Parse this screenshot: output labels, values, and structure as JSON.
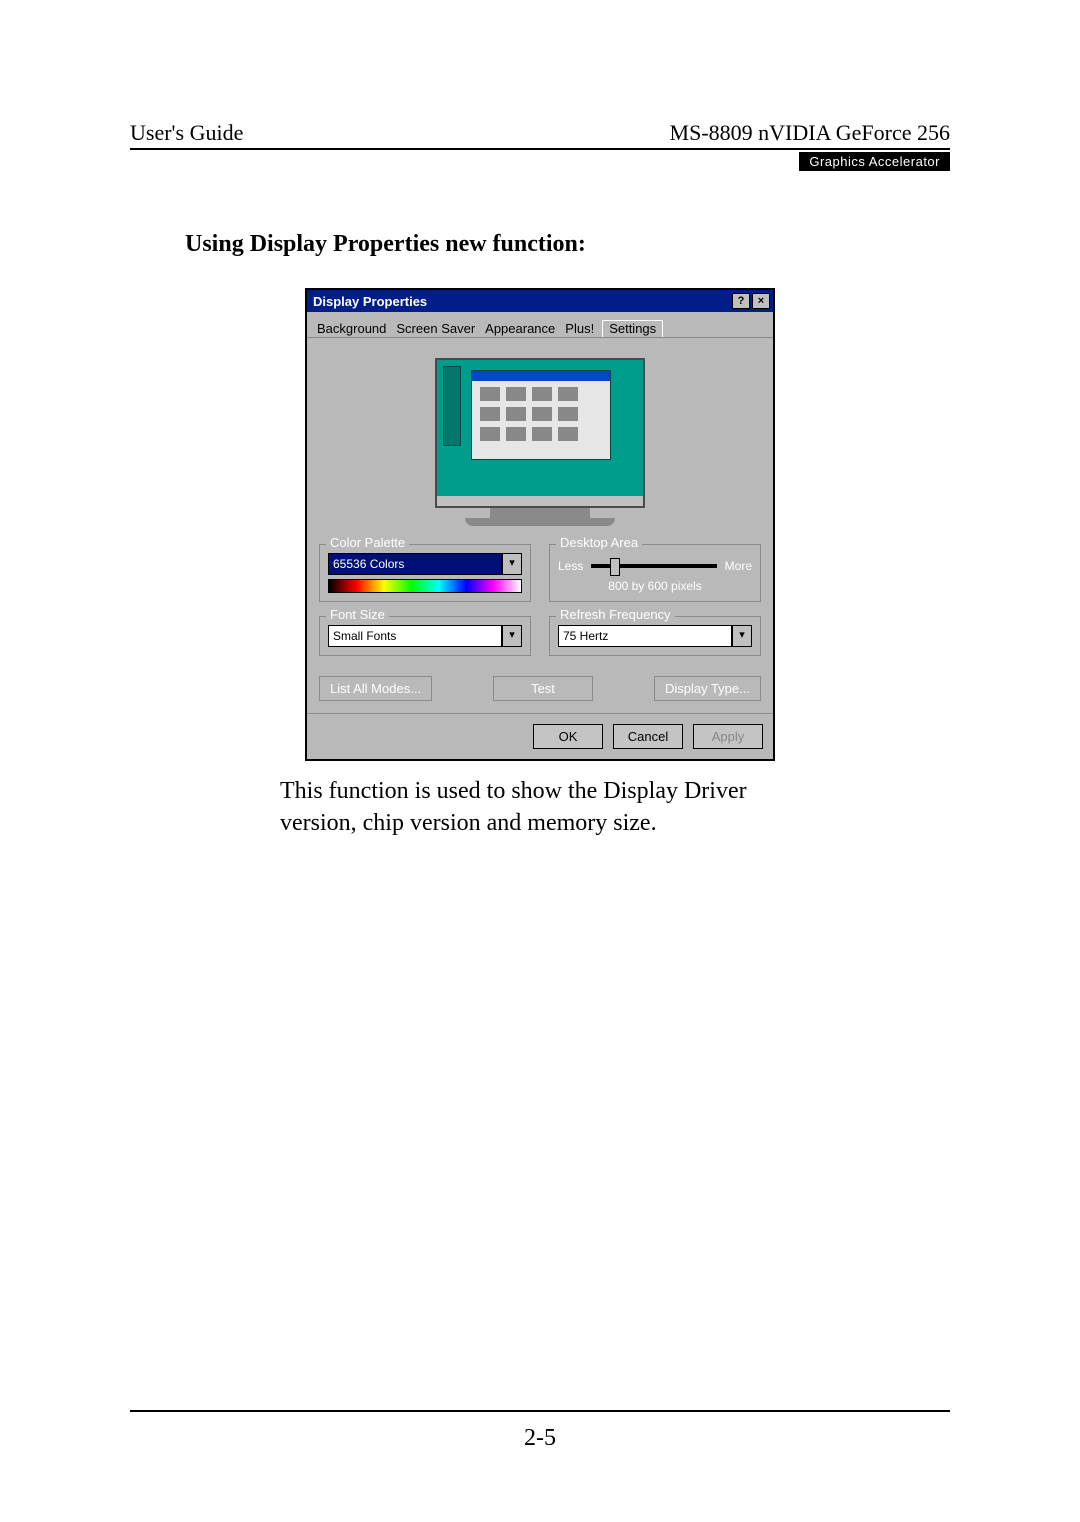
{
  "header": {
    "left": "User's Guide",
    "right": "MS-8809 nVIDIA GeForce 256",
    "badge": "Graphics Accelerator"
  },
  "section_title": "Using Display Properties new function:",
  "dialog": {
    "title": "Display Properties",
    "help_btn": "?",
    "close_btn": "×",
    "tabs": {
      "background": "Background",
      "screensaver": "Screen Saver",
      "appearance": "Appearance",
      "plus": "Plus!",
      "settings": "Settings"
    },
    "color_palette": {
      "label": "Color Palette",
      "value": "65536 Colors",
      "arrow": "▾"
    },
    "desktop_area": {
      "label": "Desktop Area",
      "less": "Less",
      "more": "More",
      "value": "800 by 600 pixels"
    },
    "font_size": {
      "label": "Font Size",
      "value": "Small Fonts",
      "arrow": "▾"
    },
    "refresh": {
      "label": "Refresh Frequency",
      "value": "75 Hertz",
      "arrow": "▾"
    },
    "buttons": {
      "list_modes": "List All Modes...",
      "test": "Test",
      "display_type": "Display Type..."
    },
    "bottom": {
      "ok": "OK",
      "cancel": "Cancel",
      "apply": "Apply"
    }
  },
  "caption": "This function is used to show the Display Driver version, chip version and memory size.",
  "page_number": "2-5"
}
